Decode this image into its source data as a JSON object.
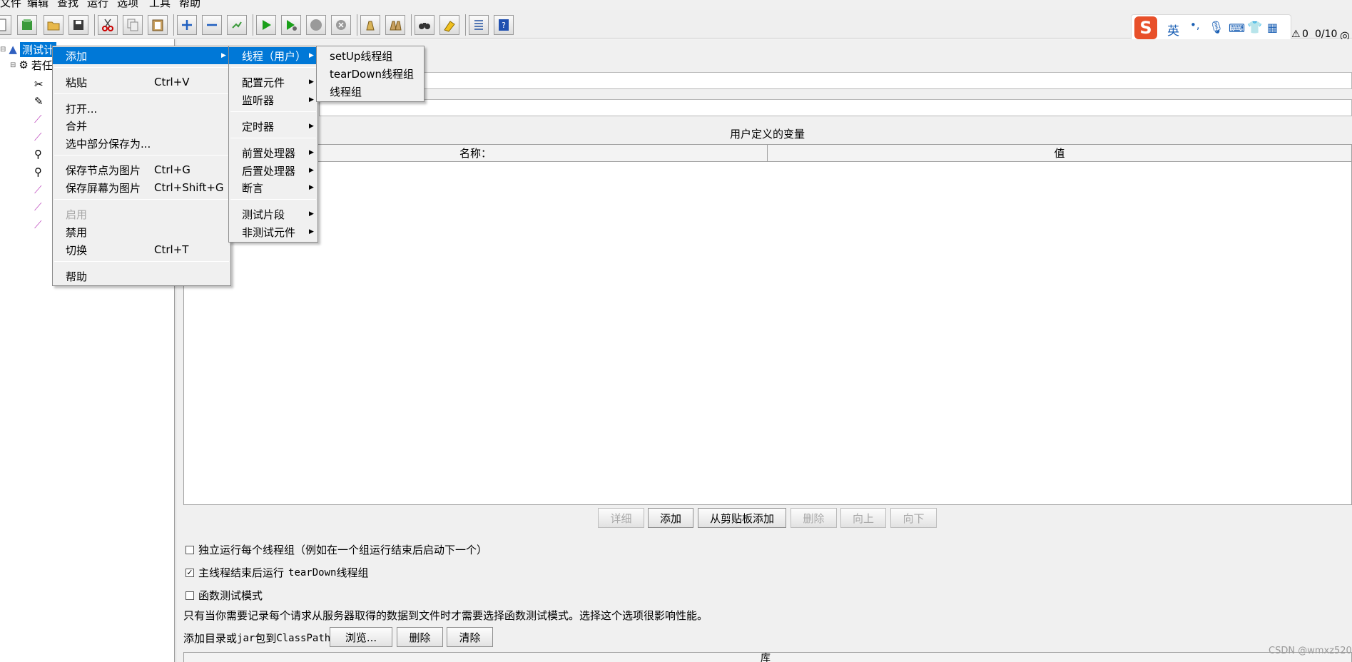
{
  "menubar": [
    "文件",
    "编辑",
    "查找",
    "运行",
    "选项",
    "工具",
    "帮助"
  ],
  "toolbar": {
    "buttons": [
      "new-icon",
      "templates-icon",
      "open-icon",
      "save-icon",
      "cut-icon",
      "copy-icon",
      "paste-icon",
      "expand-icon",
      "collapse-icon",
      "toggle-icon",
      "start-icon",
      "start-no-pause-icon",
      "stop-icon",
      "shutdown-icon",
      "clear-icon",
      "clear-all-icon",
      "search-icon",
      "reset-search-icon",
      "function-helper-icon",
      "help-icon"
    ],
    "warning_count": "0",
    "thread_count": "0/10"
  },
  "ime": {
    "lang": "英",
    "punct": "•,"
  },
  "tree": {
    "root": "测试计",
    "child": "若任"
  },
  "context_menu": {
    "items": [
      {
        "label": "添加",
        "accel": "",
        "submenu": true,
        "selected": true
      },
      {
        "label": "粘贴",
        "accel": "Ctrl+V"
      },
      {
        "label": "打开...",
        "accel": ""
      },
      {
        "label": "合并",
        "accel": ""
      },
      {
        "label": "选中部分保存为...",
        "accel": ""
      },
      {
        "label": "保存节点为图片",
        "accel": "Ctrl+G"
      },
      {
        "label": "保存屏幕为图片",
        "accel": "Ctrl+Shift+G"
      },
      {
        "label": "启用",
        "accel": "",
        "disabled": true
      },
      {
        "label": "禁用",
        "accel": ""
      },
      {
        "label": "切换",
        "accel": "Ctrl+T"
      },
      {
        "label": "帮助",
        "accel": ""
      }
    ]
  },
  "add_submenu": {
    "items": [
      "线程（用户）",
      "配置元件",
      "监听器",
      "定时器",
      "前置处理器",
      "后置处理器",
      "断言",
      "测试片段",
      "非测试元件"
    ]
  },
  "thread_submenu": {
    "items": [
      "setUp线程组",
      "tearDown线程组",
      "线程组"
    ]
  },
  "main": {
    "udv_title": "用户定义的变量",
    "col_name": "名称：",
    "col_value": "值",
    "buttons": {
      "detail": "详细",
      "add": "添加",
      "add_clipboard": "从剪贴板添加",
      "delete": "删除",
      "up": "向上",
      "down": "向下"
    },
    "option1": "独立运行每个线程组（例如在一个组运行结束后启动下一个）",
    "option2_prefix": "主线程结束后运行",
    "option2_mono": "tearDown",
    "option2_suffix": "线程组",
    "option3": "函数测试模式",
    "note": "只有当你需要记录每个请求从服务器取得的数据到文件时才需要选择函数测试模式。选择这个选项很影响性能。",
    "classpath_label_a": "添加目录或",
    "classpath_label_mono": "jar",
    "classpath_label_b": "包到",
    "classpath_label_mono2": "ClassPath",
    "browse": "浏览...",
    "cp_delete": "删除",
    "cp_clear": "清除",
    "lib_header": "库"
  },
  "watermark": "CSDN @wmxz520"
}
